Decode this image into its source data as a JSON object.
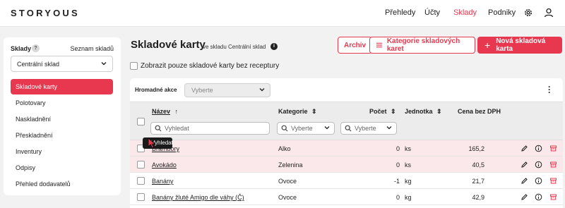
{
  "brand": "STORYOUS",
  "nav": {
    "items": [
      "Přehledy",
      "Účty",
      "Sklady",
      "Podniky"
    ],
    "active": "Sklady",
    "icons": [
      "gear-icon",
      "user-icon"
    ]
  },
  "sidebar": {
    "title": "Sklady",
    "help": "?",
    "list_link": "Seznam skladů",
    "warehouse": "Centrální sklad",
    "items": [
      "Skladové karty",
      "Polotovary",
      "Naskladnění",
      "Přeskladnění",
      "Inventury",
      "Odpisy",
      "Přehled dodavatelů"
    ],
    "active_item": "Skladové karty"
  },
  "header": {
    "title": "Skladové karty",
    "subtitle": "ve skladu Centrální sklad",
    "info": "i"
  },
  "buttons": {
    "archive": "Archiv",
    "categories": "Kategorie skladových karet",
    "new_card": "Nová skladová karta"
  },
  "filter": {
    "label": "Zobrazit pouze skladové karty bez receptury",
    "checked": false
  },
  "bulk": {
    "label": "Hromadné akce",
    "placeholder": "Vyberte"
  },
  "table": {
    "columns": {
      "name": "Název",
      "category": "Kategorie",
      "count": "Počet",
      "unit": "Jednotka",
      "price": "Cena bez DPH"
    },
    "search_placeholder": "Vyhledat",
    "select_placeholder": "Vyberte",
    "rows": [
      {
        "name": "Brambory",
        "category": "Alko",
        "count": "0",
        "unit": "ks",
        "price": "165,2",
        "highlight": true
      },
      {
        "name": "Avokádo",
        "category": "Zelenina",
        "count": "0",
        "unit": "ks",
        "price": "40,5",
        "highlight": true
      },
      {
        "name": "Banány",
        "category": "Ovoce",
        "count": "-1",
        "unit": "kg",
        "price": "21,7",
        "highlight": false
      },
      {
        "name": "Banány žluté Amigo dle váhy (Č)",
        "category": "Ovoce",
        "count": "0",
        "unit": "kg",
        "price": "42,9",
        "highlight": false
      }
    ]
  },
  "tooltip": "Vyhledat",
  "colors": {
    "accent": "#e8384f",
    "highlight_row": "#fbe8ea",
    "header_bg": "#ececec",
    "page_bg": "#f2f2f2"
  }
}
